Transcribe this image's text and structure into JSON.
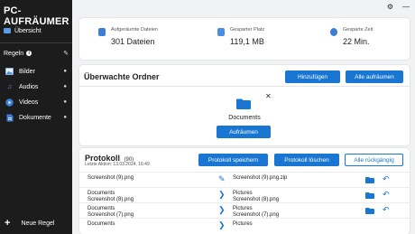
{
  "app": {
    "title": "PC-AUFRÄUMER"
  },
  "sidebar": {
    "overview": "Übersicht",
    "rules_label": "Regeln",
    "rules": [
      {
        "label": "Bilder",
        "icon": "image-icon"
      },
      {
        "label": "Audios",
        "icon": "music-icon"
      },
      {
        "label": "Videos",
        "icon": "play-icon"
      },
      {
        "label": "Dokumente",
        "icon": "document-icon"
      }
    ],
    "new_rule": "Neue Regel"
  },
  "stats": [
    {
      "label": "Aufgeräumte Dateien",
      "value": "301 Dateien",
      "icon": "files-icon"
    },
    {
      "label": "Gesparter Platz",
      "value": "119,1 MB",
      "icon": "storage-icon"
    },
    {
      "label": "Gesparte Zeit",
      "value": "22 Min.",
      "icon": "clock-icon"
    }
  ],
  "watched": {
    "title": "Überwachte Ordner",
    "add": "Hinzufügen",
    "clean_all": "Alle aufräumen",
    "folder": {
      "name": "Documents",
      "action": "Aufräumen"
    }
  },
  "protocol": {
    "title": "Protokoll",
    "count": "(90)",
    "last_action": "Letzte Aktion: 13.03.2024, 16:49",
    "save": "Protokoll speichern",
    "delete": "Protokoll löschen",
    "undo_all": "Alle rückgängig",
    "rows": [
      {
        "src1": "Screenshot (9).png",
        "src2": "",
        "dst1": "Screenshot (9).png.zip",
        "dst2": "",
        "kind": "rename"
      },
      {
        "src1": "Documents",
        "src2": "Screenshot (8).png",
        "dst1": "Pictures",
        "dst2": "Screenshot (8).png",
        "kind": "move"
      },
      {
        "src1": "Documents",
        "src2": "Screenshot (7).png",
        "dst1": "Pictures",
        "dst2": "Screenshot (7).png",
        "kind": "move"
      },
      {
        "src1": "Documents",
        "src2": "",
        "dst1": "Pictures",
        "dst2": "",
        "kind": "move"
      }
    ]
  },
  "colors": {
    "accent": "#1976d2",
    "sidebar": "#1c1c1c",
    "folder": "#1976d2"
  }
}
